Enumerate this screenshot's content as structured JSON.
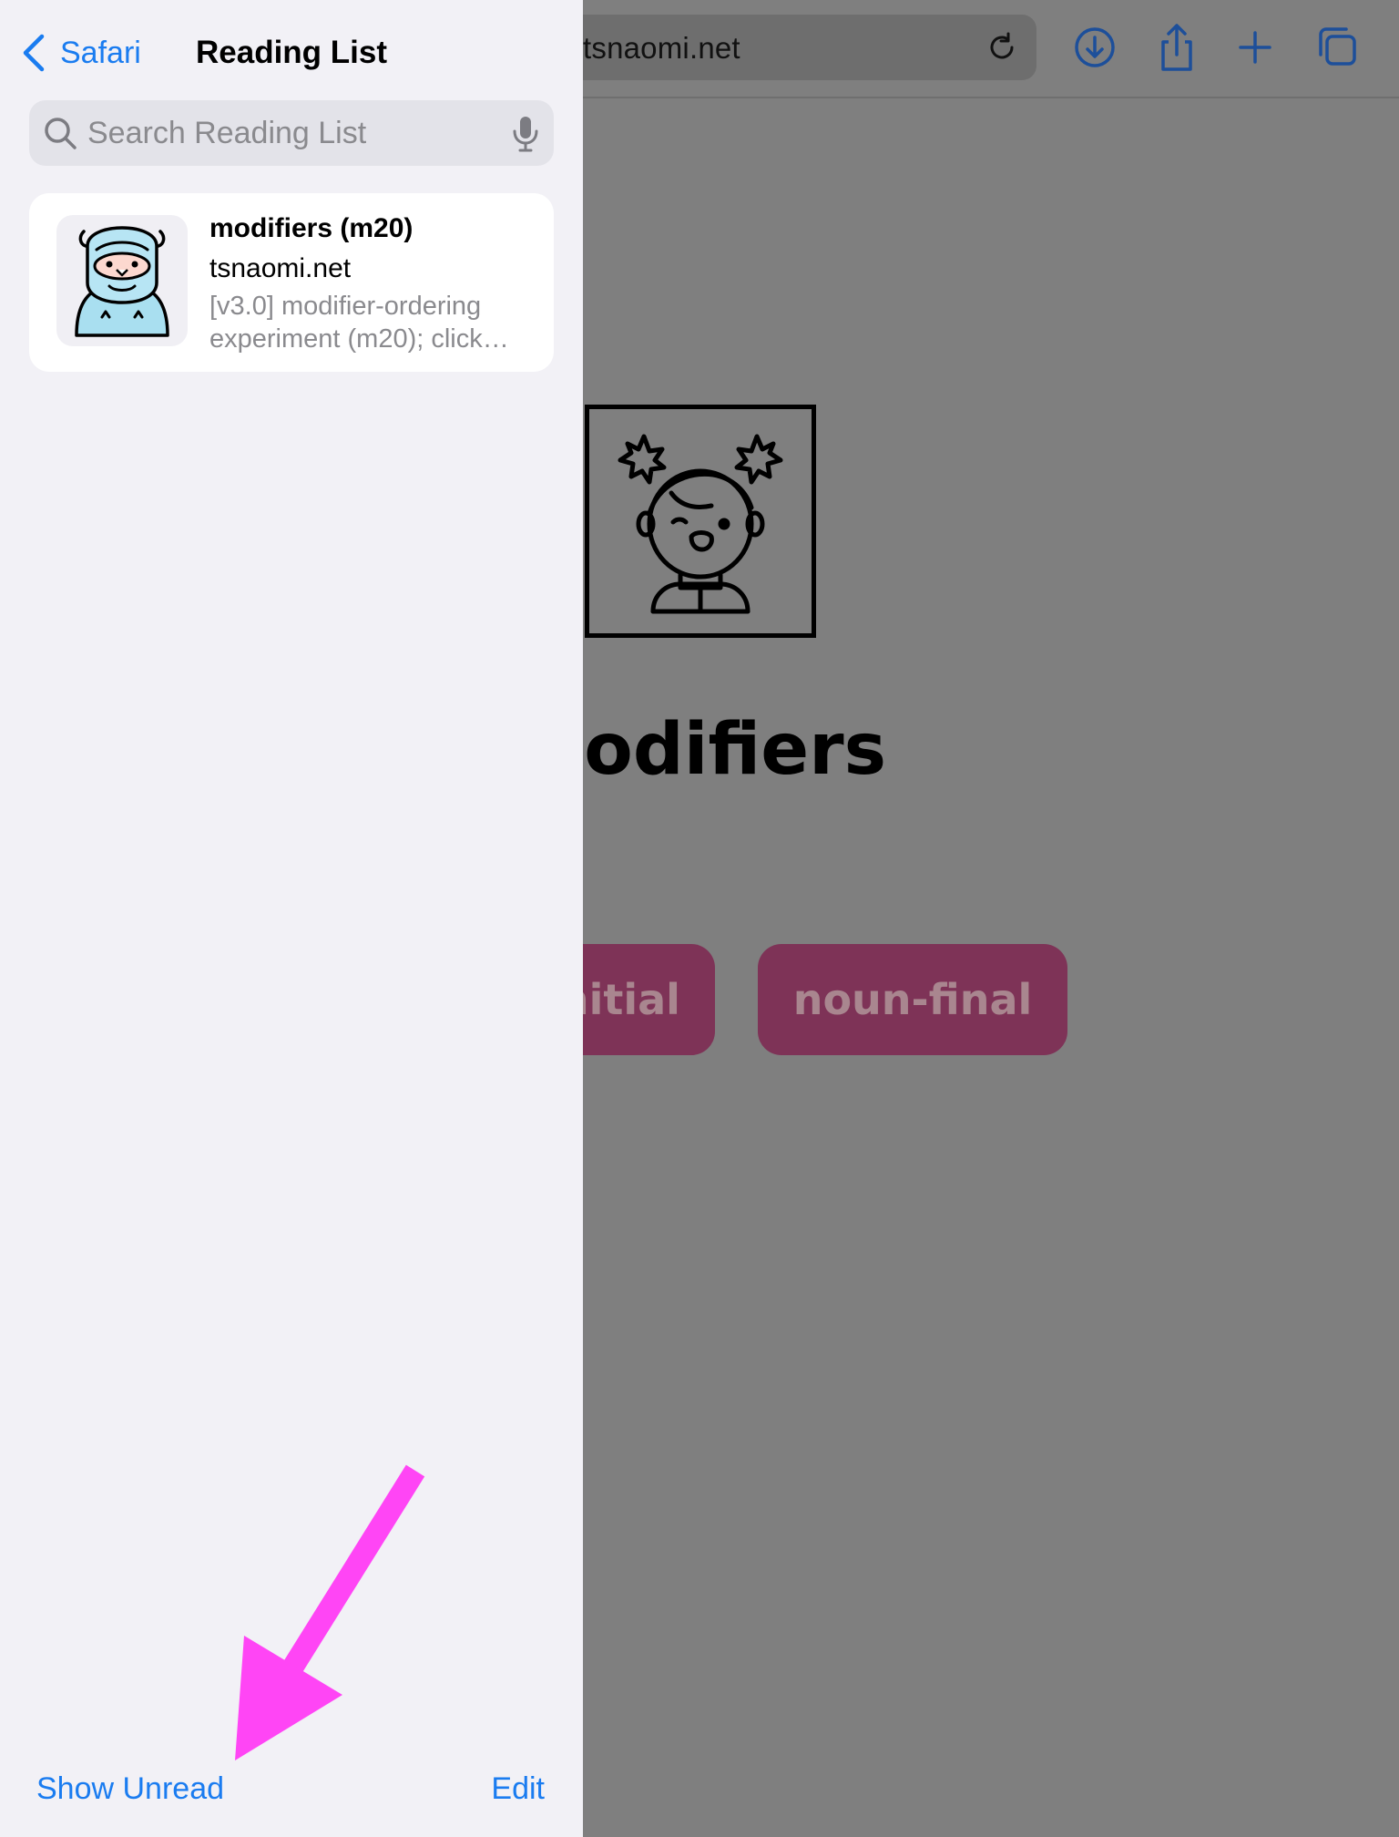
{
  "browser": {
    "url_display": "tsnaomi.net",
    "toolbar_icons": [
      "reload-icon",
      "download-icon",
      "share-icon",
      "new-tab-icon",
      "tabs-icon"
    ]
  },
  "page": {
    "heading": "modifiers",
    "choices": [
      "initial",
      "noun-final"
    ],
    "choice_color": "#7e3357"
  },
  "reading_list": {
    "back_label": "Safari",
    "title": "Reading List",
    "search_placeholder": "Search Reading List",
    "items": [
      {
        "title": "modifiers (m20)",
        "domain": "tsnaomi.net",
        "description_line1": "[v3.0] modifier-ordering",
        "description_line2": "experiment (m20); click…",
        "thumbnail_icon": "yeti-avatar-icon"
      }
    ],
    "footer_left": "Show Unread",
    "footer_right": "Edit"
  },
  "colors": {
    "accent": "#1a7cf0",
    "annotation_arrow": "#ff45f5",
    "sidebar_bg": "#f2f1f6",
    "dim_overlay": "#7f7f7f"
  }
}
